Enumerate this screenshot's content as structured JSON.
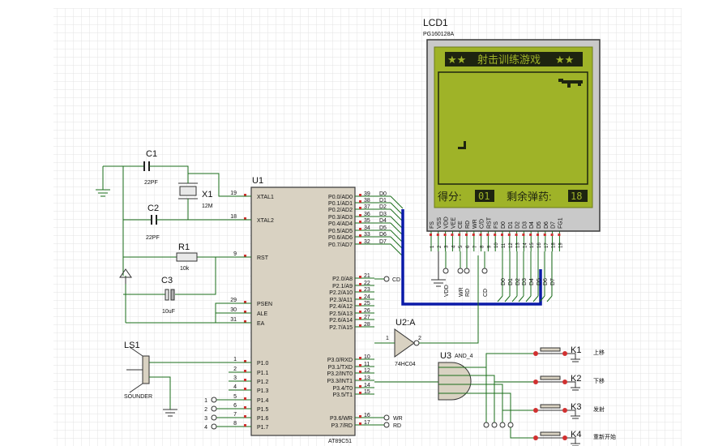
{
  "lcd": {
    "ref": "LCD1",
    "part": "PG160128A",
    "title_stars_left": "★★",
    "title": "射击训练游戏",
    "title_stars_right": "★★",
    "score_label": "得分:",
    "score_value": "01",
    "ammo_label": "剩余弹药:",
    "ammo_value": "18",
    "pins": [
      "FS",
      "VSS",
      "VDD",
      "VEE",
      "CE",
      "RD",
      "WR",
      "C/D",
      "RST",
      "FS",
      "D0",
      "D1",
      "D2",
      "D3",
      "D4",
      "D5",
      "D6",
      "D7",
      "FG1",
      "FS"
    ],
    "pin_numbers": [
      "1",
      "2",
      "3",
      "4",
      "5",
      "6",
      "7",
      "8",
      "9",
      "10",
      "11",
      "12",
      "13",
      "14",
      "15",
      "16",
      "17",
      "18",
      "19"
    ],
    "bottom_labels": [
      "VDD",
      "WR",
      "RD",
      "CD",
      "D0",
      "D1",
      "D2",
      "D3",
      "D4",
      "D5",
      "D6",
      "D7"
    ]
  },
  "mcu": {
    "ref": "U1",
    "part": "AT89C51",
    "left_pins": [
      {
        "num": "19",
        "name": "XTAL1"
      },
      {
        "num": "18",
        "name": "XTAL2"
      },
      {
        "num": "9",
        "name": "RST"
      },
      {
        "num": "29",
        "name": "PSEN"
      },
      {
        "num": "30",
        "name": "ALE"
      },
      {
        "num": "31",
        "name": "EA"
      },
      {
        "num": "1",
        "name": "P1.0"
      },
      {
        "num": "2",
        "name": "P1.1"
      },
      {
        "num": "3",
        "name": "P1.2"
      },
      {
        "num": "4",
        "name": "P1.3"
      },
      {
        "num": "5",
        "name": "P1.4"
      },
      {
        "num": "6",
        "name": "P1.5"
      },
      {
        "num": "7",
        "name": "P1.6"
      },
      {
        "num": "8",
        "name": "P1.7"
      }
    ],
    "right_pins": [
      {
        "num": "39",
        "name": "P0.0/AD0",
        "net": "D0"
      },
      {
        "num": "38",
        "name": "P0.1/AD1",
        "net": "D1"
      },
      {
        "num": "37",
        "name": "P0.2/AD2",
        "net": "D2"
      },
      {
        "num": "36",
        "name": "P0.3/AD3",
        "net": "D3"
      },
      {
        "num": "35",
        "name": "P0.4/AD4",
        "net": "D4"
      },
      {
        "num": "34",
        "name": "P0.5/AD5",
        "net": "D5"
      },
      {
        "num": "33",
        "name": "P0.6/AD6",
        "net": "D6"
      },
      {
        "num": "32",
        "name": "P0.7/AD7",
        "net": "D7"
      },
      {
        "num": "21",
        "name": "P2.0/A8",
        "net": "CD"
      },
      {
        "num": "22",
        "name": "P2.1/A9",
        "net": ""
      },
      {
        "num": "23",
        "name": "P2.2/A10",
        "net": ""
      },
      {
        "num": "24",
        "name": "P2.3/A11",
        "net": ""
      },
      {
        "num": "25",
        "name": "P2.4/A12",
        "net": ""
      },
      {
        "num": "26",
        "name": "P2.5/A13",
        "net": ""
      },
      {
        "num": "27",
        "name": "P2.6/A14",
        "net": ""
      },
      {
        "num": "28",
        "name": "P2.7/A15",
        "net": ""
      },
      {
        "num": "10",
        "name": "P3.0/RXD",
        "net": ""
      },
      {
        "num": "11",
        "name": "P3.1/TXD",
        "net": ""
      },
      {
        "num": "12",
        "name": "P3.2/INT0",
        "net": ""
      },
      {
        "num": "13",
        "name": "P3.3/INT1",
        "net": ""
      },
      {
        "num": "14",
        "name": "P3.4/T0",
        "net": ""
      },
      {
        "num": "15",
        "name": "P3.5/T1",
        "net": ""
      },
      {
        "num": "16",
        "name": "P3.6/WR",
        "net": "WR"
      },
      {
        "num": "17",
        "name": "P3.7/RD",
        "net": "RD"
      }
    ],
    "p1_net_labels": [
      "1",
      "2",
      "3",
      "4"
    ]
  },
  "components": {
    "c1": {
      "ref": "C1",
      "value": "22PF"
    },
    "c2": {
      "ref": "C2",
      "value": "22PF"
    },
    "x1": {
      "ref": "X1",
      "value": "12M"
    },
    "r1": {
      "ref": "R1",
      "value": "10k"
    },
    "c3": {
      "ref": "C3",
      "value": "10uF"
    },
    "ls1": {
      "ref": "LS1",
      "value": "SOUNDER"
    },
    "u2": {
      "ref": "U2:A",
      "part": "74HC04",
      "pin_in": "1",
      "pin_out": "2"
    },
    "u3": {
      "ref": "U3",
      "part": "AND_4"
    }
  },
  "keys": [
    {
      "ref": "K1",
      "label": "上移"
    },
    {
      "ref": "K2",
      "label": "下移"
    },
    {
      "ref": "K3",
      "label": "发射"
    },
    {
      "ref": "K4",
      "label": "重新开始"
    }
  ],
  "colors": {
    "wire": "#1a6e1a",
    "ic_fill": "#d9d2c2",
    "lcd_frame": "#c9c9c9",
    "lcd_screen": "#9fb328",
    "lcd_text": "#1e2410",
    "bus": "#0a1aa8",
    "pin_red": "#d03030",
    "pin_blue": "#2040d0",
    "grid": "#e3e3e3"
  }
}
